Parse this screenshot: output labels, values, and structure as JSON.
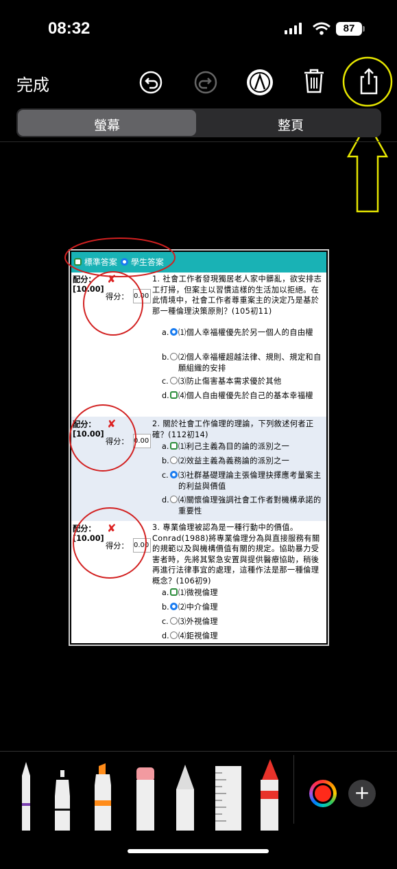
{
  "status_bar": {
    "time": "08:32",
    "battery": "87"
  },
  "toolbar": {
    "done_label": "完成",
    "icons": [
      "undo-icon",
      "redo-icon",
      "markup-pen-icon",
      "trash-icon",
      "share-icon"
    ]
  },
  "segmented": {
    "screen_label": "螢幕",
    "fullpage_label": "整頁",
    "selected": "螢幕"
  },
  "doc": {
    "tabs": {
      "standard_answer": "標準答案",
      "student_answer": "學生答案"
    },
    "score_label": "配分：",
    "score_value": "[10.00]",
    "got_label": "得分：",
    "got_value": "0.00",
    "questions": [
      {
        "text": "1. 社會工作者發現獨居老人家中髒亂，欲安排志工打掃，但案主以習慣這樣的生活加以拒絕。在此情境中，社會工作者尊重案主的決定乃是基於那一種倫理決策原則？(105初11)",
        "options": [
          {
            "letter": "a.",
            "text": "⑴個人幸福權優先於另一個人的自由權"
          },
          {
            "letter": "b.",
            "text": "⑵個人幸福權超越法律、規則、規定和自願組織的安排"
          },
          {
            "letter": "c.",
            "text": "⑶防止傷害基本需求優於其他"
          },
          {
            "letter": "d.",
            "text": "⑷個人自由權優先於自己的基本幸福權"
          }
        ]
      },
      {
        "text": "2. 關於社會工作倫理的理論，下列敘述何者正確？(112初14)",
        "options": [
          {
            "letter": "a.",
            "text": "⑴利己主義為目的論的派別之一"
          },
          {
            "letter": "b.",
            "text": "⑵效益主義為義務論的派別之一"
          },
          {
            "letter": "c.",
            "text": "⑶社群基礎理論主張倫理抉擇應考量案主的利益與價值"
          },
          {
            "letter": "d.",
            "text": "⑷關懷倫理強調社會工作者對機構承諾的重要性"
          }
        ]
      },
      {
        "text": "3. 專業倫理被認為是一種行動中的價值。Conrad(1988)將專業倫理分為與直接服務有關的規範以及與機構價值有關的規定。協助暴力受害者時，先將其緊急安置與提供醫療協助，稍後再進行法律事宜的處理，這種作法是那一種倫理概念？(106初9)",
        "options": [
          {
            "letter": "a.",
            "text": "⑴微視倫理"
          },
          {
            "letter": "b.",
            "text": "⑵中介倫理"
          },
          {
            "letter": "c.",
            "text": "⑶外視倫理"
          },
          {
            "letter": "d.",
            "text": "⑷鉅視倫理"
          }
        ]
      }
    ]
  },
  "tools": [
    "pen-tool",
    "monoline-tool",
    "highlighter-tool",
    "eraser-tool",
    "pencil-tool",
    "ruler-tool",
    "crayon-tool"
  ],
  "accent": {
    "annotation_red": "#d22020",
    "annotation_yellow": "#e6e600",
    "selected_radio": "#1a7cf0",
    "teal": "#19b2b5"
  }
}
